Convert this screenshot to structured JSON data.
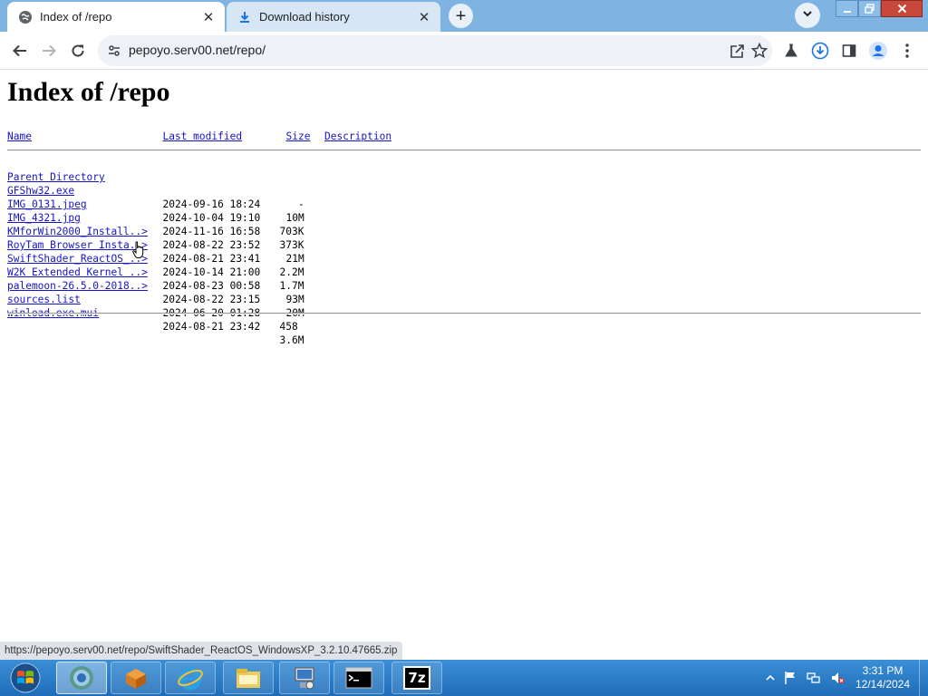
{
  "browser": {
    "tabs": [
      {
        "title": "Index of /repo",
        "active": true,
        "icon": "globe-icon"
      },
      {
        "title": "Download history",
        "active": false,
        "icon": "download-icon"
      }
    ],
    "new_tab_symbol": "+",
    "close_symbol": "✕",
    "address": "pepoyo.serv00.net/repo/",
    "status_url": "https://pepoyo.serv00.net/repo/SwiftShader_ReactOS_WindowsXP_3.2.10.47665.zip"
  },
  "page": {
    "title": "Index of /repo",
    "columns": {
      "name": "Name",
      "last_modified": "Last modified",
      "size": "Size",
      "description": "Description"
    },
    "entries": [
      {
        "name": "Parent Directory",
        "modified": "",
        "size": "-"
      },
      {
        "name": "GFShw32.exe",
        "modified": "2024-09-16 18:24",
        "size": "10M"
      },
      {
        "name": "IMG_0131.jpeg",
        "modified": "2024-10-04 19:10",
        "size": "703K"
      },
      {
        "name": "IMG_4321.jpg",
        "modified": "2024-11-16 16:58",
        "size": "373K"
      },
      {
        "name": "KMforWin2000_Install..>",
        "modified": "2024-08-22 23:52",
        "size": "21M"
      },
      {
        "name": "RoyTam Browser Insta..>",
        "modified": "2024-08-21 23:41",
        "size": "2.2M"
      },
      {
        "name": "SwiftShader_ReactOS_..>",
        "modified": "2024-10-14 21:00",
        "size": "1.7M"
      },
      {
        "name": "W2K Extended Kernel ..>",
        "modified": "2024-08-23 00:58",
        "size": "93M"
      },
      {
        "name": "palemoon-26.5.0-2018..>",
        "modified": "2024-08-22 23:15",
        "size": "20M"
      },
      {
        "name": "sources.list",
        "modified": "2024-06-20 01:28",
        "size": "458"
      },
      {
        "name": "winload.exe.mui",
        "modified": "2024-08-21 23:42",
        "size": "3.6M"
      }
    ]
  },
  "taskbar": {
    "apps": [
      {
        "name": "chrome-icon",
        "active": true
      },
      {
        "name": "package-icon",
        "active": false
      },
      {
        "name": "internet-explorer-icon",
        "active": false
      },
      {
        "name": "file-explorer-icon",
        "active": false
      },
      {
        "name": "network-setup-icon",
        "active": false
      },
      {
        "name": "command-prompt-icon",
        "active": false
      },
      {
        "name": "7zip-icon",
        "active": false
      }
    ],
    "seven_zip_label": "7z",
    "time": "3:31 PM",
    "date": "12/14/2024"
  },
  "colors": {
    "link": "#1515c8",
    "titlebar": "#7fb4e2",
    "taskbar": "#2a7cc8"
  }
}
